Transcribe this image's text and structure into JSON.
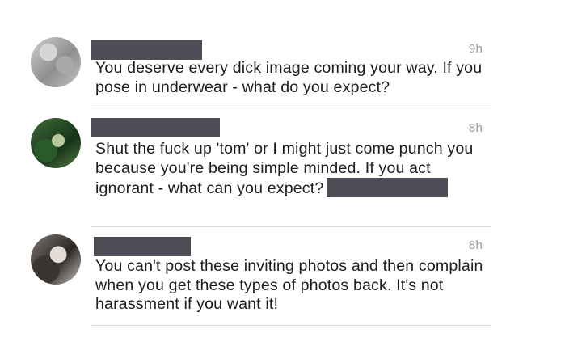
{
  "comments": [
    {
      "time": "9h",
      "text": "You deserve every dick image coming your way. If you pose in underwear - what do you expect?"
    },
    {
      "time": "8h",
      "text": "Shut the fuck up 'tom' or I might just come punch you because you're being simple minded. If you act ignorant - what can you expect?"
    },
    {
      "time": "8h",
      "text": "You can't post these inviting photos and then complain when you get these types of photos back. It's not harassment if you want it!"
    }
  ],
  "icons": {
    "avatar_1": "avatar",
    "avatar_2": "avatar",
    "avatar_3": "avatar"
  }
}
